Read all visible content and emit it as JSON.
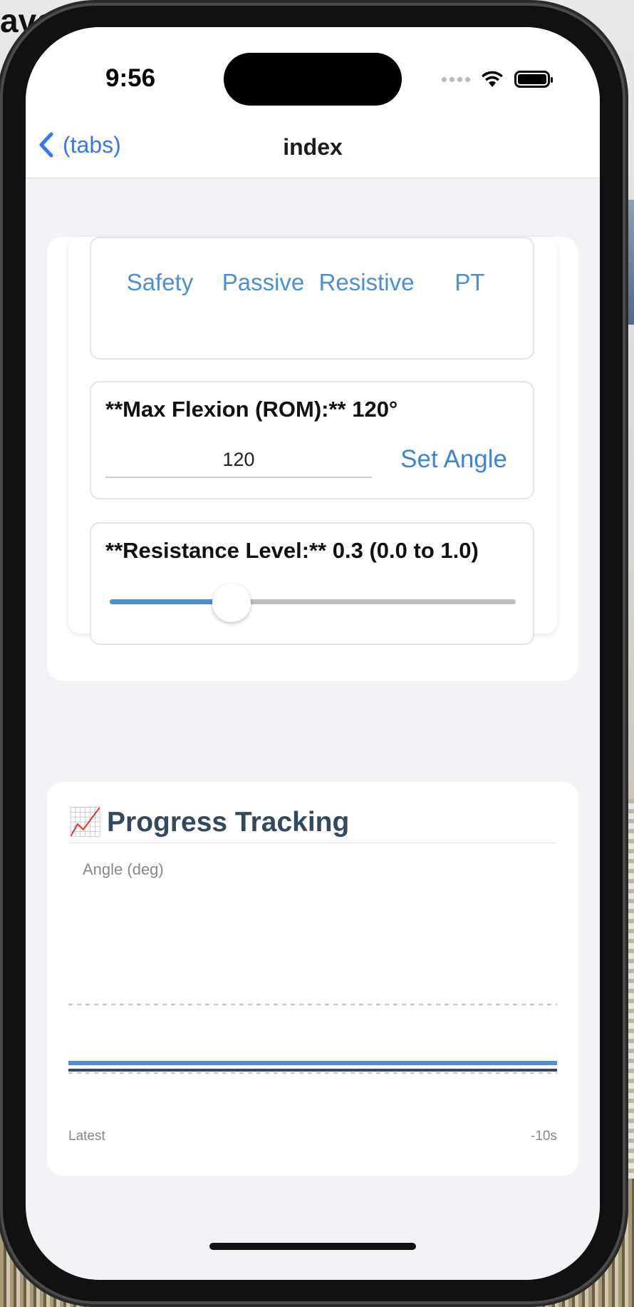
{
  "background": {
    "top_text": "aved"
  },
  "status_bar": {
    "time": "9:56"
  },
  "nav": {
    "back_label": "(tabs)",
    "title": "index"
  },
  "modes": {
    "tabs": [
      "Safety",
      "Passive",
      "Resistive",
      "PT"
    ]
  },
  "rom": {
    "label": "**Max Flexion (ROM):** 120°",
    "input_value": "120",
    "button_label": "Set Angle"
  },
  "resistance": {
    "label": "**Resistance Level:** 0.3 (0.0 to 1.0)",
    "value": 0.3,
    "min": 0.0,
    "max": 1.0
  },
  "progress": {
    "icon": "📈",
    "title": "Progress Tracking"
  },
  "chart_data": {
    "type": "line",
    "ylabel": "Angle (deg)",
    "x_labels": [
      "Latest",
      "-10s"
    ],
    "grid": "dashed horizontal",
    "series": [
      {
        "color": "#4a90d9"
      },
      {
        "color": "#34495e"
      }
    ]
  },
  "colors": {
    "accent": "#3478f6",
    "link": "#4a90d9",
    "heading": "#34495e"
  }
}
